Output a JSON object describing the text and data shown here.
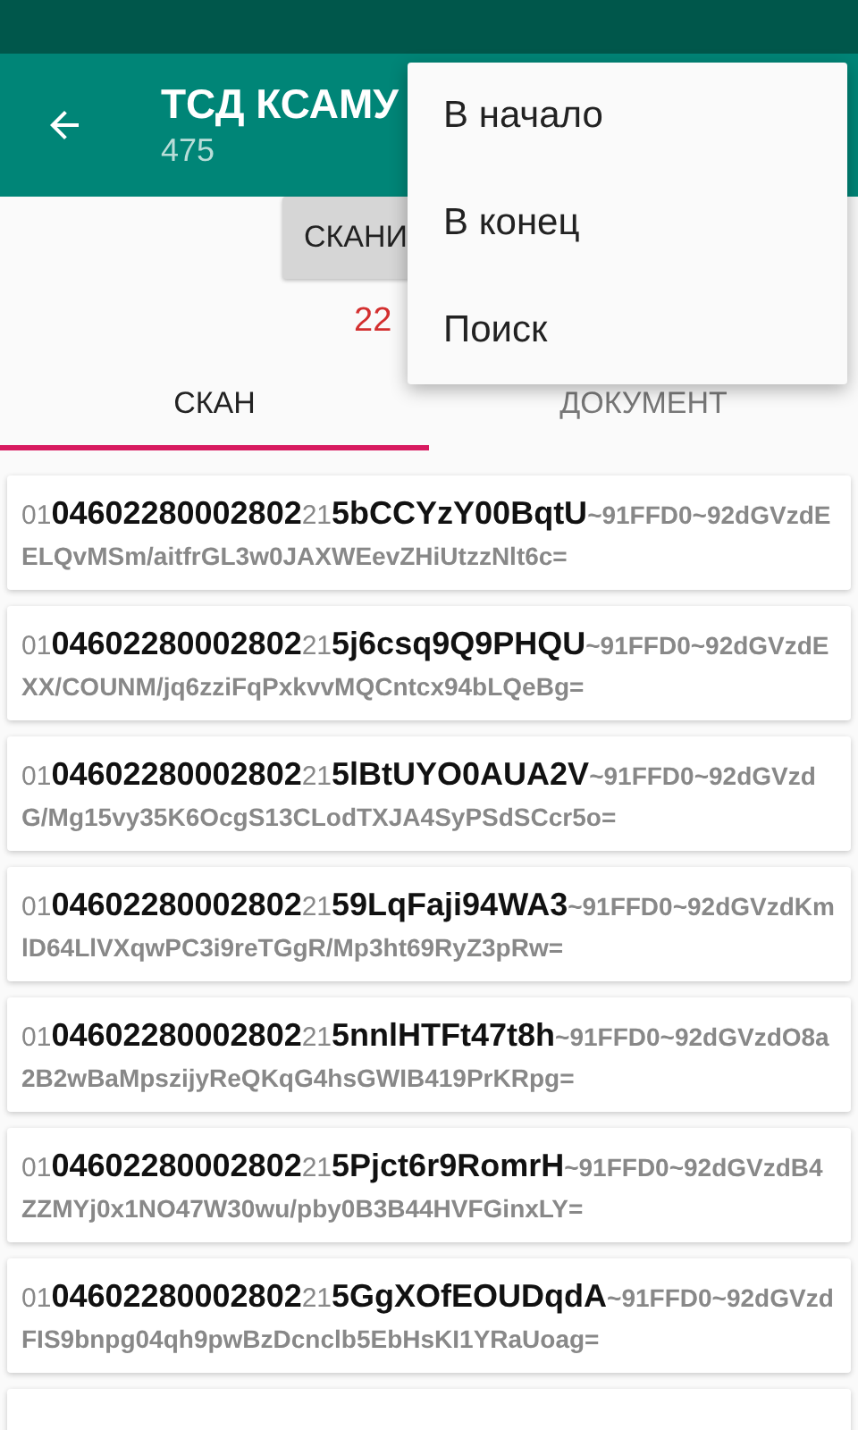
{
  "toolbar": {
    "title": "ТСД КСАМУ",
    "subtitle": "475"
  },
  "scan_button": {
    "label": "СКАНИ"
  },
  "counter": "22",
  "tabs": [
    {
      "label": "СКАН",
      "selected": true
    },
    {
      "label": "ДОКУМЕНТ",
      "selected": false
    }
  ],
  "scans": [
    {
      "ai_01": "01",
      "gtin": "04602280002802",
      "ai_21": "21",
      "serial": "5bCCYzY00BqtU",
      "tail": "~91FFD0~92dGVzdEELQvMSm/aitfrGL3w0JAXWEevZHiUtzzNlt6c="
    },
    {
      "ai_01": "01",
      "gtin": "04602280002802",
      "ai_21": "21",
      "serial": "5j6csq9Q9PHQU",
      "tail": "~91FFD0~92dGVzdEXX/COUNM/jq6zziFqPxkvvMQCntcx94bLQeBg="
    },
    {
      "ai_01": "01",
      "gtin": "04602280002802",
      "ai_21": "21",
      "serial": "5lBtUYO0AUA2V",
      "tail": "~91FFD0~92dGVzdG/Mg15vy35K6OcgS13CLodTXJA4SyPSdSCcr5o="
    },
    {
      "ai_01": "01",
      "gtin": "04602280002802",
      "ai_21": "21",
      "serial": "59LqFaji94WA3",
      "tail": "~91FFD0~92dGVzdKmlD64LlVXqwPC3i9reTGgR/Mp3ht69RyZ3pRw="
    },
    {
      "ai_01": "01",
      "gtin": "04602280002802",
      "ai_21": "21",
      "serial": "5nnlHTFt47t8h",
      "tail": "~91FFD0~92dGVzdO8a2B2wBaMpszijyReQKqG4hsGWIB419PrKRpg="
    },
    {
      "ai_01": "01",
      "gtin": "04602280002802",
      "ai_21": "21",
      "serial": "5Pjct6r9RomrH",
      "tail": "~91FFD0~92dGVzdB4ZZMYj0x1NO47W30wu/pby0B3B44HVFGinxLY="
    },
    {
      "ai_01": "01",
      "gtin": "04602280002802",
      "ai_21": "21",
      "serial": "5GgXOfEOUDqdA",
      "tail": "~91FFD0~92dGVzdFIS9bnpg04qh9pwBzDcnclb5EbHsKI1YRaUoag="
    }
  ],
  "overflow_menu": [
    "В начало",
    "В конец",
    "Поиск"
  ]
}
